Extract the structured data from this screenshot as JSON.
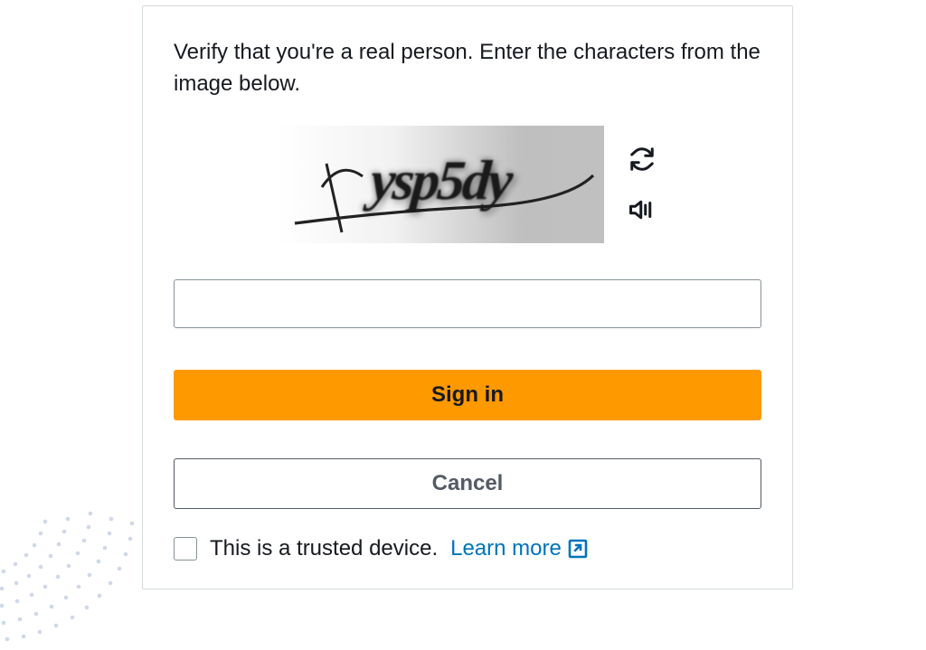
{
  "instructions": "Verify that you're a real person. Enter the characters from the image below.",
  "captcha": {
    "text": "ysp5dy",
    "refresh_label": "Refresh captcha",
    "audio_label": "Audio captcha"
  },
  "input": {
    "value": "",
    "placeholder": ""
  },
  "buttons": {
    "signin": "Sign in",
    "cancel": "Cancel"
  },
  "trusted": {
    "label": "This is a trusted device.",
    "learn_more": "Learn more"
  }
}
